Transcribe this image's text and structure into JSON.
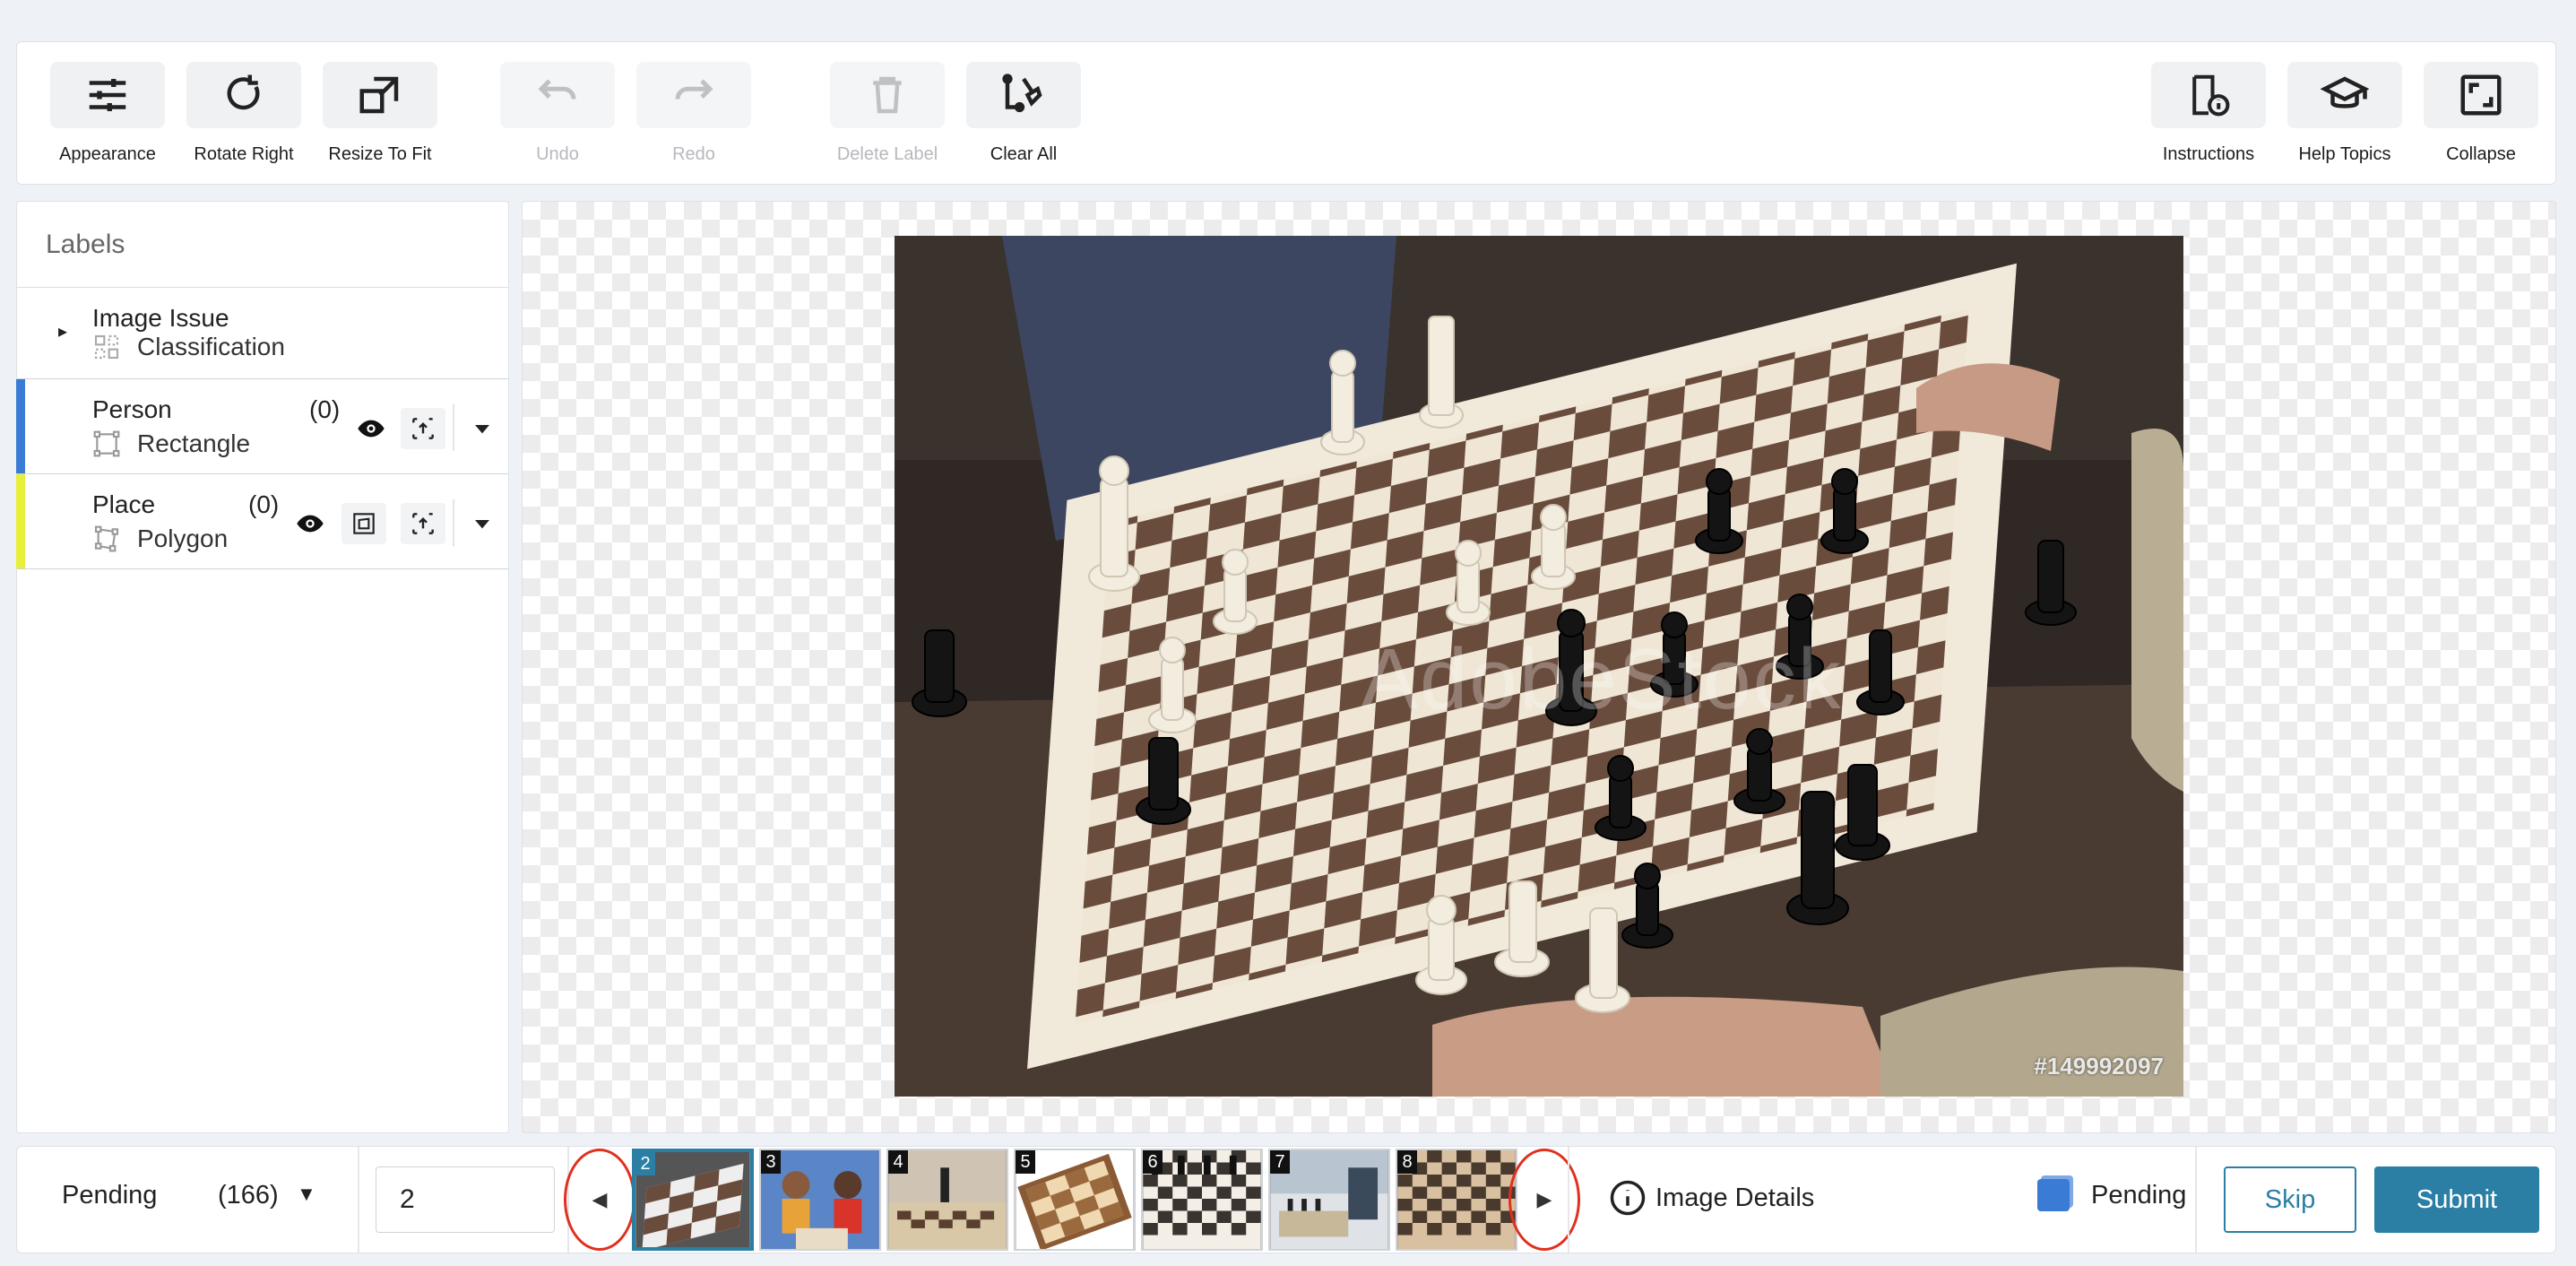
{
  "toolbar": {
    "appearance": "Appearance",
    "rotate_right": "Rotate Right",
    "resize_to_fit": "Resize To Fit",
    "undo": "Undo",
    "redo": "Redo",
    "delete_label": "Delete Label",
    "clear_all": "Clear All",
    "instructions": "Instructions",
    "help_topics": "Help Topics",
    "collapse": "Collapse"
  },
  "labels": {
    "title": "Labels",
    "items": [
      {
        "name": "Image Issue",
        "type": "Classification"
      },
      {
        "name": "Person",
        "type": "Rectangle",
        "count": "(0)",
        "color": "#3a7bd5"
      },
      {
        "name": "Place",
        "type": "Polygon",
        "count": "(0)",
        "color": "#e8ef3a"
      }
    ]
  },
  "image": {
    "stock_id": "#149992097",
    "watermark": "AdobeStock"
  },
  "bottom": {
    "status": "Pending",
    "status_count": "(166)",
    "page_value": "2",
    "thumbnails": [
      "2",
      "3",
      "4",
      "5",
      "6",
      "7",
      "8"
    ],
    "image_details": "Image Details",
    "pending_flag": "Pending",
    "skip": "Skip",
    "submit": "Submit"
  },
  "colors": {
    "accent": "#2b7fa5",
    "nav_highlight": "#e0301e"
  },
  "icons": [
    "sliders-icon",
    "rotate-icon",
    "resize-icon",
    "undo-icon",
    "redo-icon",
    "trash-icon",
    "clear-all-icon",
    "instructions-icon",
    "graduation-cap-icon",
    "collapse-icon",
    "eye-icon",
    "polygon-icon",
    "share-icon",
    "caret-down-icon",
    "info-icon",
    "chevron-left-icon",
    "chevron-right-icon"
  ]
}
